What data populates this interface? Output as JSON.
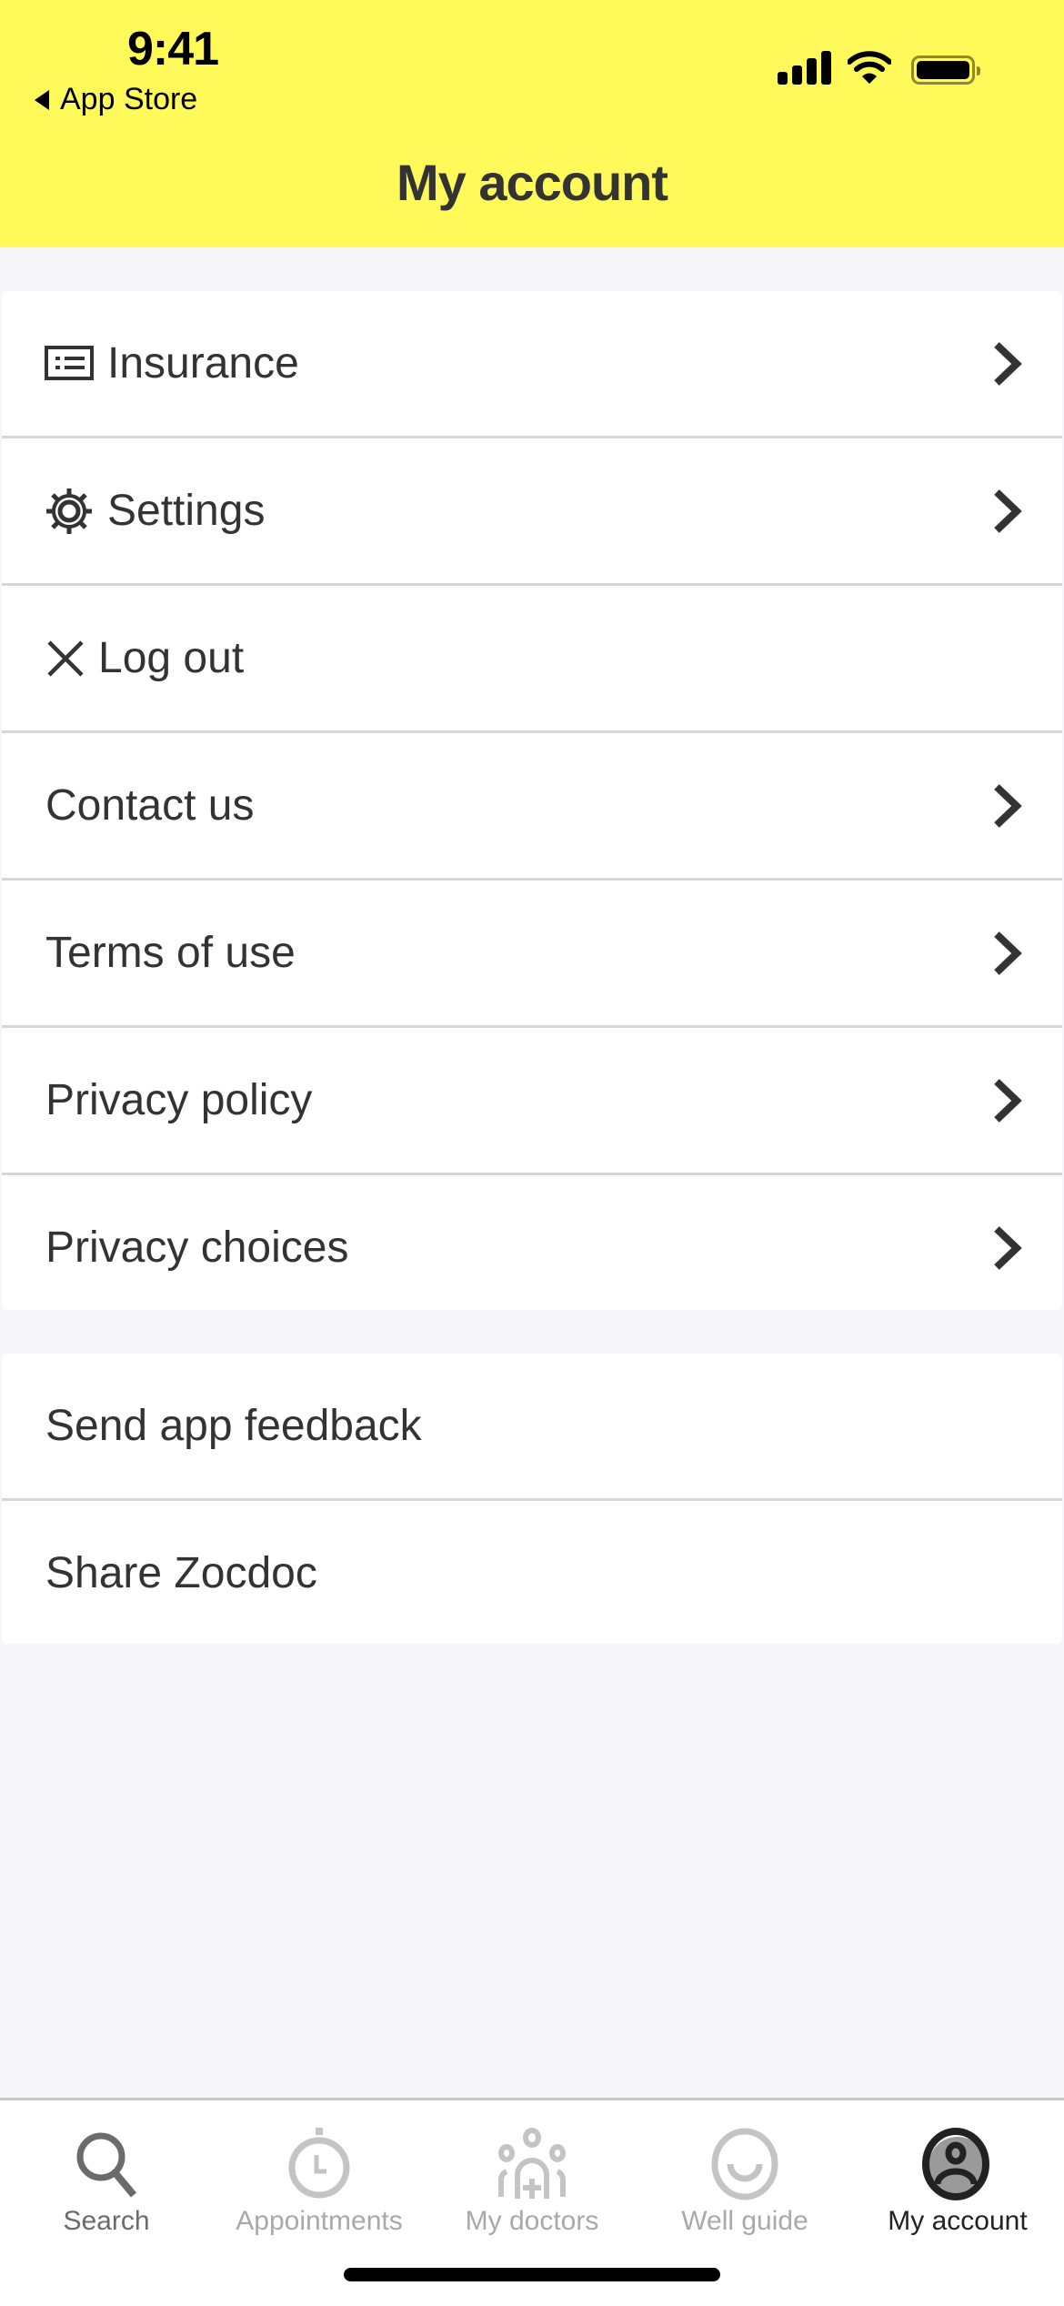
{
  "status_bar": {
    "time": "9:41",
    "back_app": "App Store"
  },
  "header": {
    "title": "My account",
    "background": "#fffa5a"
  },
  "menu_primary": [
    {
      "label": "Insurance",
      "icon": "insurance-card-icon",
      "chevron": true
    },
    {
      "label": "Settings",
      "icon": "gear-icon",
      "chevron": true
    },
    {
      "label": "Log out",
      "icon": "close-icon",
      "chevron": false
    },
    {
      "label": "Contact us",
      "icon": null,
      "chevron": true
    },
    {
      "label": "Terms of use",
      "icon": null,
      "chevron": true
    },
    {
      "label": "Privacy policy",
      "icon": null,
      "chevron": true
    },
    {
      "label": "Privacy choices",
      "icon": null,
      "chevron": true
    }
  ],
  "menu_secondary": [
    {
      "label": "Send app feedback"
    },
    {
      "label": "Share Zocdoc"
    }
  ],
  "tab_bar": {
    "tabs": [
      {
        "label": "Search",
        "icon": "search-icon",
        "active": false
      },
      {
        "label": "Appointments",
        "icon": "stopwatch-icon",
        "active": false
      },
      {
        "label": "My doctors",
        "icon": "doctors-group-icon",
        "active": false
      },
      {
        "label": "Well guide",
        "icon": "smile-icon",
        "active": false
      },
      {
        "label": "My account",
        "icon": "user-avatar-icon",
        "active": true
      }
    ]
  }
}
